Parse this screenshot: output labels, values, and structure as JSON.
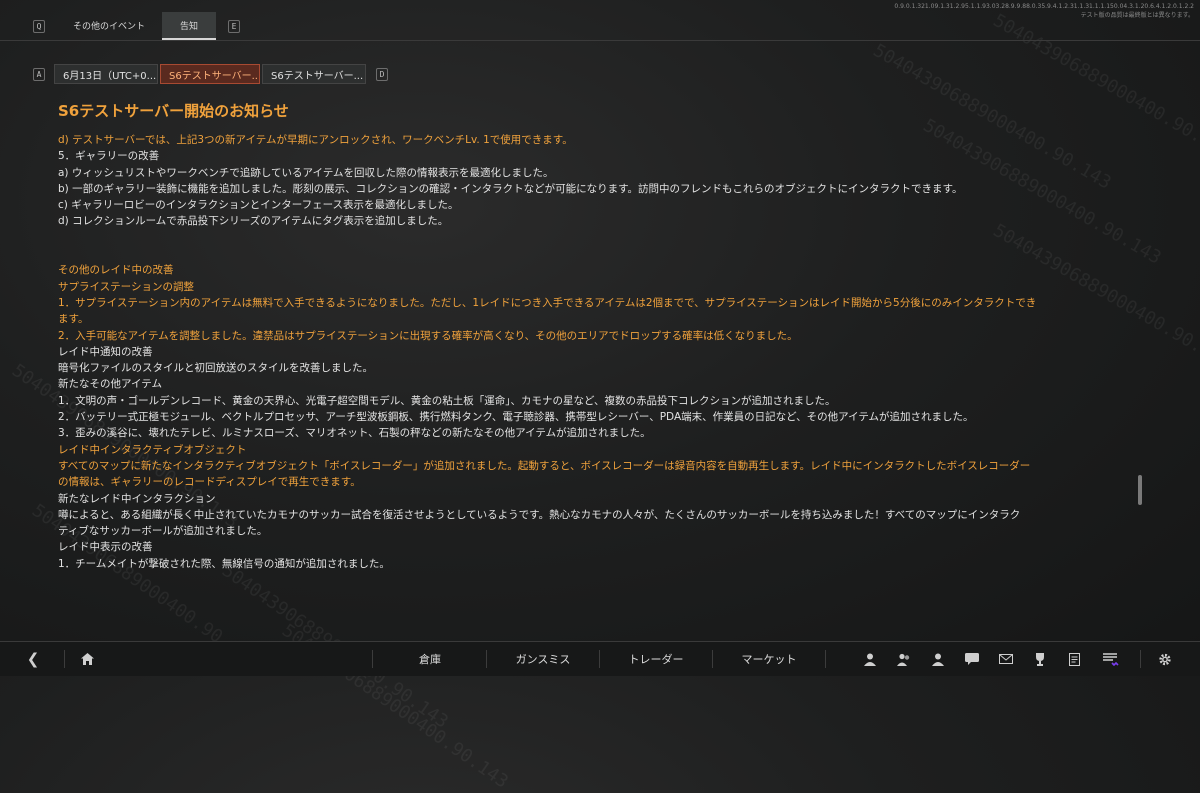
{
  "top_tabs": {
    "key_left": "Q",
    "key_right": "E",
    "items": [
      {
        "label": "その他のイベント"
      },
      {
        "label": "告知"
      }
    ]
  },
  "build_info": {
    "line1": "0.9.0.1.321.09.1.31.2.95.1.1.93.03.28.9.9.88.0.35.9.4.1.2.31.1.31.1.1.150.04.3.1.20.6.4.1.2.0.1.2.2",
    "line2": "テスト版の品質は最終版とは異なります。"
  },
  "sub_tabs": {
    "key_left": "A",
    "key_right": "D",
    "items": [
      {
        "label": "6月13日（UTC+0..."
      },
      {
        "label": "S6テストサーバー..."
      },
      {
        "label": "S6テストサーバー..."
      }
    ]
  },
  "article": {
    "title": "S6テストサーバー開始のお知らせ",
    "lines": [
      "d) テストサーバーでは、上記3つの新アイテムが早期にアンロックされ、ワークベンチLv. 1で使用できます。",
      "5．ギャラリーの改善",
      "a) ウィッシュリストやワークベンチで追跡しているアイテムを回収した際の情報表示を最適化しました。",
      "b) 一部のギャラリー装飾に機能を追加しました。彫刻の展示、コレクションの確認・インタラクトなどが可能になります。訪問中のフレンドもこれらのオブジェクトにインタラクトできます。",
      "c) ギャラリーロビーのインタラクションとインターフェース表示を最適化しました。",
      "d) コレクションルームで赤品投下シリーズのアイテムにタグ表示を追加しました。",
      "",
      "",
      "その他のレイド中の改善",
      "サプライステーションの調整",
      "1．サプライステーション内のアイテムは無料で入手できるようになりました。ただし、1レイドにつき入手できるアイテムは2個までで、サプライステーションはレイド開始から5分後にのみインタラクトでき",
      "ます。",
      "2．入手可能なアイテムを調整しました。違禁品はサプライステーションに出現する確率が高くなり、その他のエリアでドロップする確率は低くなりました。",
      "レイド中通知の改善",
      "暗号化ファイルのスタイルと初回放送のスタイルを改善しました。",
      "新たなその他アイテム",
      "1．文明の声・ゴールデンレコード、黄金の天界心、光電子超空間モデル、黄金の粘土板「運命」、カモナの星など、複数の赤品投下コレクションが追加されました。",
      "2．バッテリー式正極モジュール、ベクトルプロセッサ、アーチ型波板鋼板、携行燃料タンク、電子聴診器、携帯型レシーバー、PDA端末、作業員の日記など、その他アイテムが追加されました。",
      "3．歪みの溪谷に、壊れたテレビ、ルミナスローズ、マリオネット、石製の秤などの新たなその他アイテムが追加されました。",
      "レイド中インタラクティブオブジェクト",
      "すべてのマップに新たなインタラクティブオブジェクト「ボイスレコーダー」が追加されました。起動すると、ボイスレコーダーは録音内容を自動再生します。レイド中にインタラクトしたボイスレコーダー",
      "の情報は、ギャラリーのレコードディスプレイで再生できます。",
      "新たなレイド中インタラクション",
      "噂によると、ある組織が長く中止されていたカモナのサッカー試合を復活させようとしているようです。熱心なカモナの人々が、たくさんのサッカーボールを持ち込みました！すべてのマップにインタラク",
      "ティブなサッカーボールが追加されました。",
      "レイド中表示の改善",
      "1．チームメイトが撃破された際、無線信号の通知が追加されました。"
    ],
    "line_colors": [
      "o",
      "w",
      "w",
      "w",
      "w",
      "w",
      "blank",
      "blank",
      "o",
      "o",
      "o",
      "o",
      "o",
      "w",
      "w",
      "w",
      "w",
      "w",
      "w",
      "o",
      "o",
      "o",
      "w",
      "w",
      "w",
      "w",
      "w"
    ]
  },
  "bottom_nav": {
    "items": [
      {
        "label": "倉庫"
      },
      {
        "label": "ガンスミス"
      },
      {
        "label": "トレーダー"
      },
      {
        "label": "マーケット"
      }
    ],
    "icons": [
      "back-arrow-icon",
      "home-icon",
      "character-icon",
      "squad-icon",
      "friends-icon",
      "chat-icon",
      "mail-icon",
      "trophy-icon",
      "tasks-icon",
      "event-icon",
      "settings-icon"
    ]
  },
  "watermark": "504043906889000400.90.143"
}
